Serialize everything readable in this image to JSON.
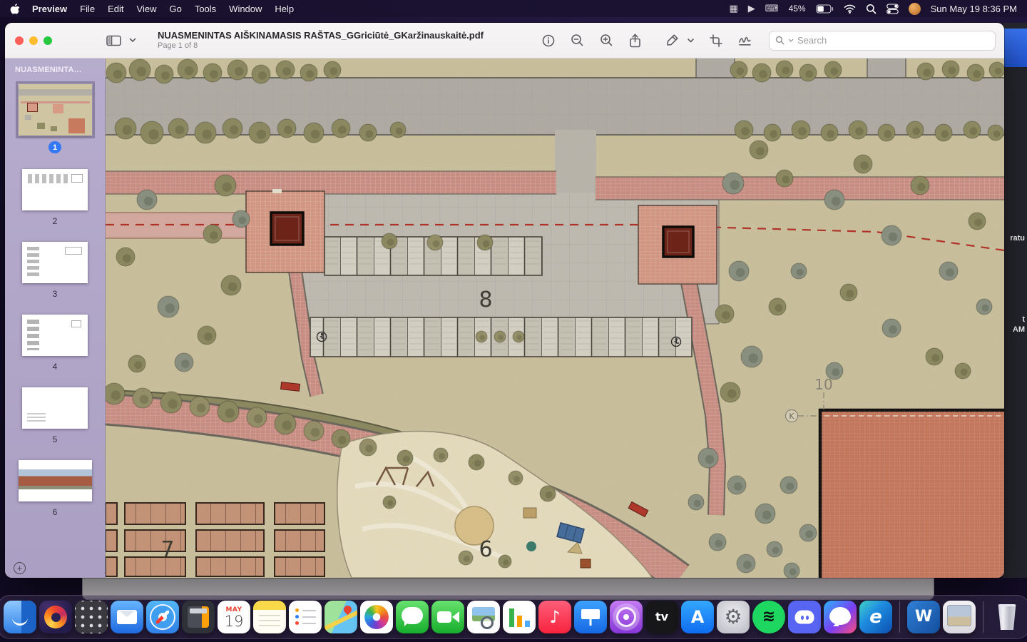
{
  "menu_bar": {
    "app_name": "Preview",
    "items": [
      "File",
      "Edit",
      "View",
      "Go",
      "Tools",
      "Window",
      "Help"
    ],
    "status": {
      "battery": "45%",
      "clock": "Sun May 19  8:36 PM",
      "icons": [
        {
          "name": "grid",
          "glyph": "▦"
        },
        {
          "name": "playback",
          "glyph": "▶"
        },
        {
          "name": "keyboard",
          "glyph": "⌨"
        }
      ]
    }
  },
  "window": {
    "title": "NUASMENINTAS AIŠKINAMASIS RAŠTAS_GGriciūtė_GKaržinauskaitė.pdf",
    "page_indicator": "Page 1 of 8",
    "search_placeholder": "Search"
  },
  "sidebar": {
    "header": "NUASMENINTA…",
    "add_button_glyph": "+",
    "pages": [
      {
        "label": "1",
        "selected": true
      },
      {
        "label": "2"
      },
      {
        "label": "3"
      },
      {
        "label": "4"
      },
      {
        "label": "5"
      },
      {
        "label": "6"
      }
    ]
  },
  "plan": {
    "labels": {
      "eight": "8",
      "six": "6",
      "seven": "7",
      "ten": "10",
      "k": "K"
    }
  },
  "background_window": {
    "fragments": {
      "one": "ratu",
      "two": "t",
      "three": "AM"
    }
  },
  "dock": {
    "calendar": {
      "month": "MAY",
      "day": "19"
    },
    "items": [
      {
        "name": "finder"
      },
      {
        "name": "firefox"
      },
      {
        "name": "launchpad"
      },
      {
        "name": "mail"
      },
      {
        "name": "safari"
      },
      {
        "name": "calculator"
      },
      {
        "name": "calendar"
      },
      {
        "name": "notes"
      },
      {
        "name": "reminders"
      },
      {
        "name": "maps"
      },
      {
        "name": "photos"
      },
      {
        "name": "messages"
      },
      {
        "name": "facetime"
      },
      {
        "name": "preview"
      },
      {
        "name": "numbers"
      },
      {
        "name": "music",
        "glyph": "♪"
      },
      {
        "name": "keynote"
      },
      {
        "name": "podcasts"
      },
      {
        "name": "appletv",
        "glyph": "tv"
      },
      {
        "name": "appstore",
        "glyph": "A"
      },
      {
        "name": "settings",
        "glyph": "⚙"
      },
      {
        "name": "spotify",
        "glyph": "≋"
      },
      {
        "name": "discord"
      },
      {
        "name": "messenger"
      },
      {
        "name": "edge",
        "glyph": "e"
      },
      {
        "name": "separator"
      },
      {
        "name": "word",
        "glyph": "W"
      },
      {
        "name": "screenshot"
      },
      {
        "name": "separator"
      },
      {
        "name": "trash"
      }
    ]
  }
}
